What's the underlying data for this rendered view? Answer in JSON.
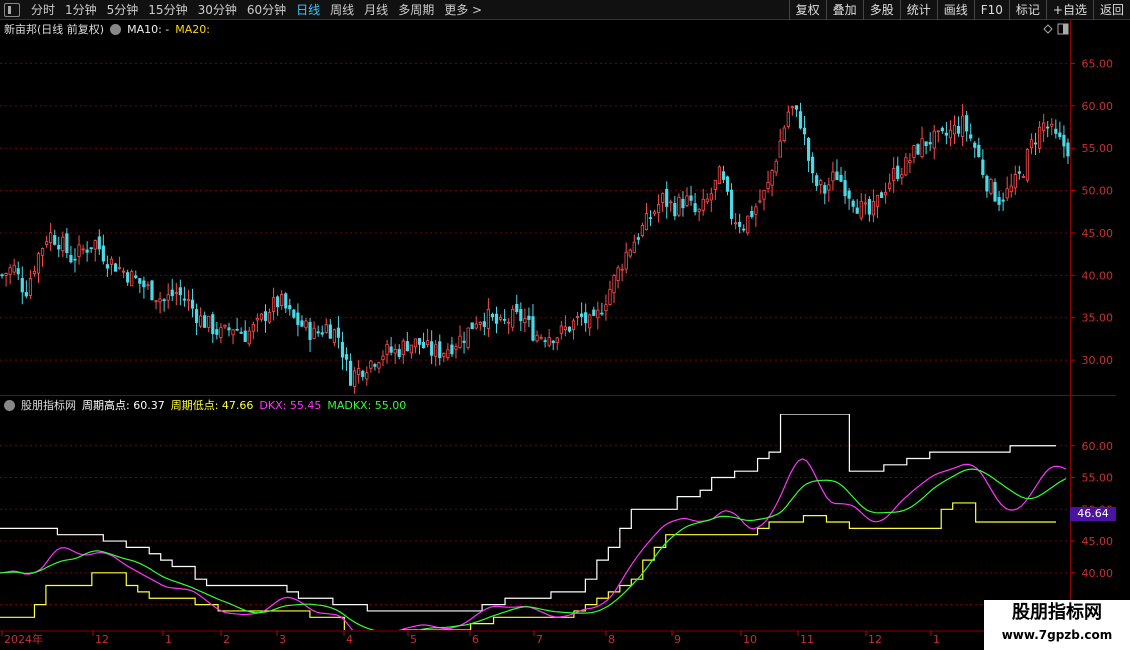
{
  "toolbar": {
    "tabs": [
      {
        "label": "分时",
        "active": false
      },
      {
        "label": "1分钟",
        "active": false
      },
      {
        "label": "5分钟",
        "active": false
      },
      {
        "label": "15分钟",
        "active": false
      },
      {
        "label": "30分钟",
        "active": false
      },
      {
        "label": "60分钟",
        "active": false
      },
      {
        "label": "日线",
        "active": true
      },
      {
        "label": "周线",
        "active": false
      },
      {
        "label": "月线",
        "active": false
      },
      {
        "label": "多周期",
        "active": false
      },
      {
        "label": "更多 >",
        "active": false
      }
    ],
    "right_buttons": [
      "复权",
      "叠加",
      "多股",
      "统计",
      "画线",
      "F10",
      "标记",
      "+自选",
      "返回"
    ]
  },
  "main_chart": {
    "title": "新亩邦(日线 前复权)",
    "ma10_label": "MA10: -",
    "ma20_label": "MA20:",
    "y_ticks": [
      "65.00",
      "60.00",
      "55.00",
      "50.00",
      "45.00",
      "40.00",
      "35.00",
      "30.00"
    ]
  },
  "indicator": {
    "name": "股朋指标网",
    "high_label": "周期高点: 60.37",
    "low_label": "周期低点: 47.66",
    "dkx_label": "DKX: 55.45",
    "madkx_label": "MADKX: 55.00",
    "y_ticks": [
      "60.00",
      "55.00",
      "50.00",
      "45.00",
      "40.00",
      "35.00"
    ],
    "current_marker": "46.64"
  },
  "x_axis": {
    "labels": [
      "2024年",
      "12",
      "1",
      "2",
      "3",
      "4",
      "5",
      "6",
      "7",
      "8",
      "9",
      "10",
      "11",
      "12",
      "1"
    ]
  },
  "watermark": {
    "title": "股朋指标网",
    "url": "www.7gpzb.com"
  },
  "colors": {
    "up": "#ff4d4d",
    "down": "#4dd9e6",
    "high_line": "#ffffff",
    "low_line": "#ffff33",
    "dkx": "#ff33ff",
    "madkx": "#33ff33",
    "grid": "#7a0000"
  },
  "chart_data": {
    "type": "candlestick",
    "price_ylim": [
      26,
      68
    ],
    "indicator_ylim": [
      31,
      65
    ],
    "months": [
      "2024年",
      "12",
      "1",
      "2",
      "3",
      "4",
      "5",
      "6",
      "7",
      "8",
      "9",
      "10",
      "11",
      "12",
      "1"
    ],
    "close_path": [
      40,
      41,
      38,
      42,
      45,
      44,
      42,
      43,
      44,
      42,
      41,
      40,
      39,
      38,
      37,
      38,
      37,
      35,
      34,
      33,
      34,
      33,
      34,
      36,
      37,
      35,
      34,
      33,
      34,
      33,
      28,
      29,
      30,
      31,
      31,
      32,
      32,
      31,
      31,
      32,
      33,
      35,
      35,
      34,
      35,
      35,
      33,
      33,
      33,
      34,
      35,
      34,
      37,
      40,
      43,
      45,
      47,
      49,
      48,
      49,
      47,
      49,
      52,
      47,
      46,
      48,
      50,
      55,
      60,
      58,
      51,
      50,
      52,
      50,
      48,
      47,
      50,
      52,
      53,
      55,
      56,
      56,
      57,
      58,
      55,
      51,
      49,
      50,
      52,
      56,
      58,
      56,
      55
    ],
    "high_path": [
      47,
      47,
      47,
      47,
      47,
      46,
      46,
      46,
      46,
      45,
      45,
      44,
      44,
      43,
      42,
      41,
      41,
      39,
      38,
      38,
      38,
      38,
      38,
      38,
      38,
      37,
      36,
      36,
      36,
      35,
      35,
      35,
      34,
      34,
      34,
      34,
      34,
      34,
      34,
      34,
      34,
      34,
      35,
      35,
      36,
      36,
      36,
      36,
      37,
      37,
      37,
      39,
      42,
      44,
      47,
      50,
      50,
      50,
      50,
      52,
      52,
      53,
      55,
      55,
      56,
      56,
      58,
      59,
      65,
      65,
      65,
      65,
      65,
      65,
      56,
      56,
      56,
      57,
      57,
      58,
      58,
      59,
      59,
      59,
      59,
      59,
      59,
      59,
      60,
      60,
      60,
      60,
      60
    ],
    "low_path": [
      33,
      33,
      33,
      35,
      38,
      38,
      38,
      38,
      40,
      40,
      40,
      38,
      37,
      36,
      36,
      36,
      36,
      35,
      35,
      34,
      34,
      34,
      34,
      34,
      34,
      34,
      34,
      33,
      33,
      33,
      29,
      29,
      29,
      29,
      30,
      31,
      31,
      31,
      31,
      31,
      31,
      32,
      32,
      33,
      33,
      33,
      33,
      33,
      33,
      33,
      34,
      35,
      36,
      37,
      38,
      39,
      42,
      44,
      46,
      46,
      46,
      46,
      46,
      46,
      46,
      46,
      47,
      48,
      48,
      48,
      49,
      49,
      48,
      48,
      47,
      47,
      47,
      47,
      47,
      47,
      47,
      47,
      50,
      51,
      51,
      48,
      48,
      48,
      48,
      48,
      48,
      48,
      48
    ]
  }
}
